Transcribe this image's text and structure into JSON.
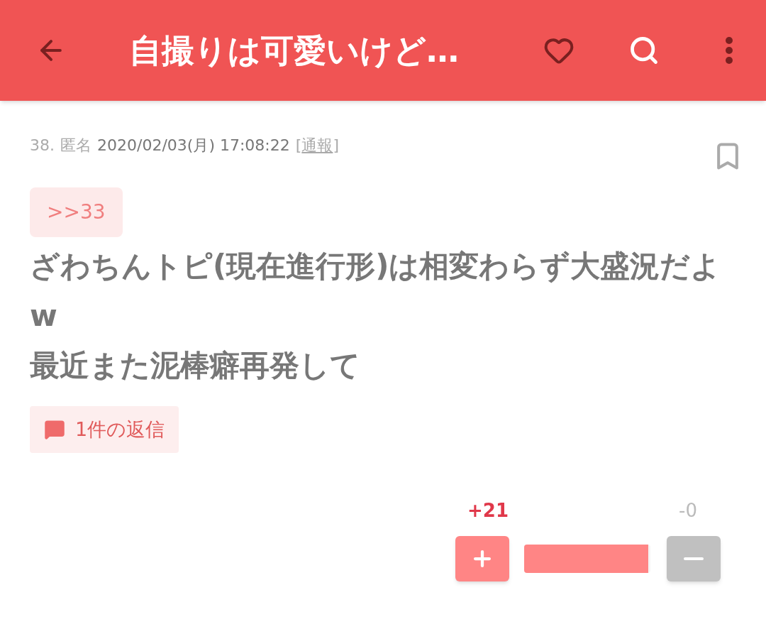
{
  "header": {
    "title": "自撮りは可愛いけど…"
  },
  "post": {
    "number": "38.",
    "author": "匿名",
    "datetime": "2020/02/03(月) 17:08:22",
    "report_open": "[",
    "report": "通報",
    "report_close": "]",
    "bookmarked": false,
    "anchor": ">>33",
    "lines": [
      "ざわちんトピ(現在進行形)は相変わらず大盛況だよ",
      "w",
      "最近また泥棒癖再発して"
    ],
    "replies": "1件の返信"
  },
  "votes": {
    "plus": "+21",
    "minus": "-0",
    "level": 1
  }
}
